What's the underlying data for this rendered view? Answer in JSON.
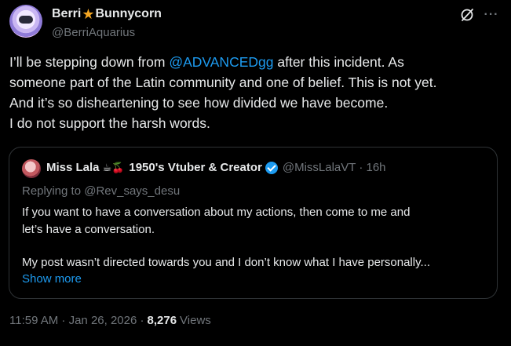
{
  "author": {
    "display_name_first": "Berri",
    "display_name_emoji": "★",
    "display_name_last": "Bunnycorn",
    "handle": "@BerriAquarius"
  },
  "header_icons": [
    "grok-icon",
    "more-icon"
  ],
  "tweet": {
    "line1_before": "I’ll be stepping down from ",
    "line1_mention": "@ADVANCEDgg",
    "line1_after": " after this incident. As",
    "line2": "someone part of the Latin community and one of belief. This is not yet.",
    "line3": "And it’s so disheartening to see how divided we have become.",
    "line4": "I do not support the harsh words."
  },
  "quote": {
    "name": "Miss Lala",
    "emojis": "☕🍒",
    "title": "1950's Vtuber & Creator",
    "handle_time": "@MissLalaVT · 16h",
    "replying_to": "Replying to @Rev_says_desu",
    "text_line1": "If you want to have a conversation about my actions, then come to me and",
    "text_line2": "let’s have a conversation.",
    "text_line3": "My post wasn’t directed towards you and I don’t know what I have personally...",
    "show_more": "Show more"
  },
  "meta": {
    "timestamp": "11:59 AM · Jan 26, 2026 ·",
    "views_count": "8,276",
    "views_label": "Views"
  },
  "colors": {
    "background": "#000000",
    "text": "#e7e9ea",
    "secondary": "#71767b",
    "link": "#1d9bf0",
    "border": "#2f3336",
    "star": "#f3a623"
  }
}
